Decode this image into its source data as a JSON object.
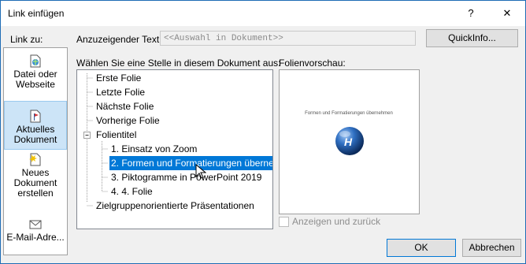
{
  "window": {
    "title": "Link einfügen",
    "help_glyph": "?",
    "close_glyph": "✕"
  },
  "labels": {
    "link_to": "Link zu:",
    "display_text": "Anzuzeigender Text:",
    "choose_place": "Wählen Sie eine Stelle in diesem Dokument aus:",
    "slide_preview": "Folienvorschau:"
  },
  "display_text_input": {
    "value": "<<Auswahl in Dokument>>"
  },
  "buttons": {
    "quickinfo": "QuickInfo...",
    "ok": "OK",
    "cancel": "Abbrechen"
  },
  "sidebar": {
    "items": [
      {
        "label": "Datei oder Webseite",
        "icon": "web-page-icon",
        "selected": false
      },
      {
        "label": "Aktuelles Dokument",
        "icon": "document-place-icon",
        "selected": true
      },
      {
        "label": "Neues Dokument erstellen",
        "icon": "new-document-icon",
        "selected": false
      },
      {
        "label": "E-Mail-Adre...",
        "icon": "email-icon",
        "selected": false
      }
    ]
  },
  "tree": {
    "items": [
      {
        "label": "Erste Folie",
        "level": 0
      },
      {
        "label": "Letzte Folie",
        "level": 0
      },
      {
        "label": "Nächste Folie",
        "level": 0
      },
      {
        "label": "Vorherige Folie",
        "level": 0
      },
      {
        "label": "Folientitel",
        "level": 0,
        "expander": "⊟"
      },
      {
        "label": "1. Einsatz von Zoom",
        "level": 1
      },
      {
        "label": "2. Formen und Formatierungen überne",
        "level": 1,
        "selected": true
      },
      {
        "label": "3. Piktogramme in PowerPoint 2019",
        "level": 1
      },
      {
        "label": "4. 4. Folie",
        "level": 1
      },
      {
        "label": "Zielgruppenorientierte Präsentationen",
        "level": 0
      }
    ]
  },
  "preview": {
    "slide_title": "Formen und Formatierungen übernehmen",
    "badge_letter": "H"
  },
  "show_and_return": {
    "label": "Anzeigen und zurück",
    "checked": false
  }
}
